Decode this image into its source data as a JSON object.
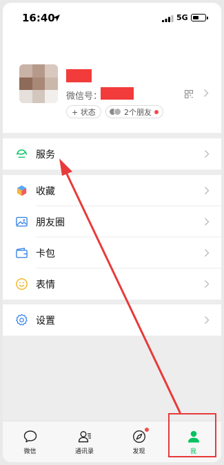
{
  "status_bar": {
    "time": "16:40",
    "network": "5G"
  },
  "profile": {
    "wechat_id_label": "微信号：",
    "status_button": "+ 状态",
    "friends_label": "2个朋友"
  },
  "menu": {
    "services": "服务",
    "favorites": "收藏",
    "moments": "朋友圈",
    "cards": "卡包",
    "stickers": "表情",
    "settings": "设置"
  },
  "tabs": [
    "微信",
    "通讯录",
    "发现",
    "我"
  ],
  "colors": {
    "accent_green": "#07c160",
    "annotation_red": "#e83a3a",
    "redaction_red": "#f23b3b"
  },
  "icons": {
    "services": "services-icon",
    "favorites": "cube-icon",
    "moments": "picture-icon",
    "cards": "wallet-icon",
    "stickers": "smiley-icon",
    "settings": "gear-icon"
  }
}
